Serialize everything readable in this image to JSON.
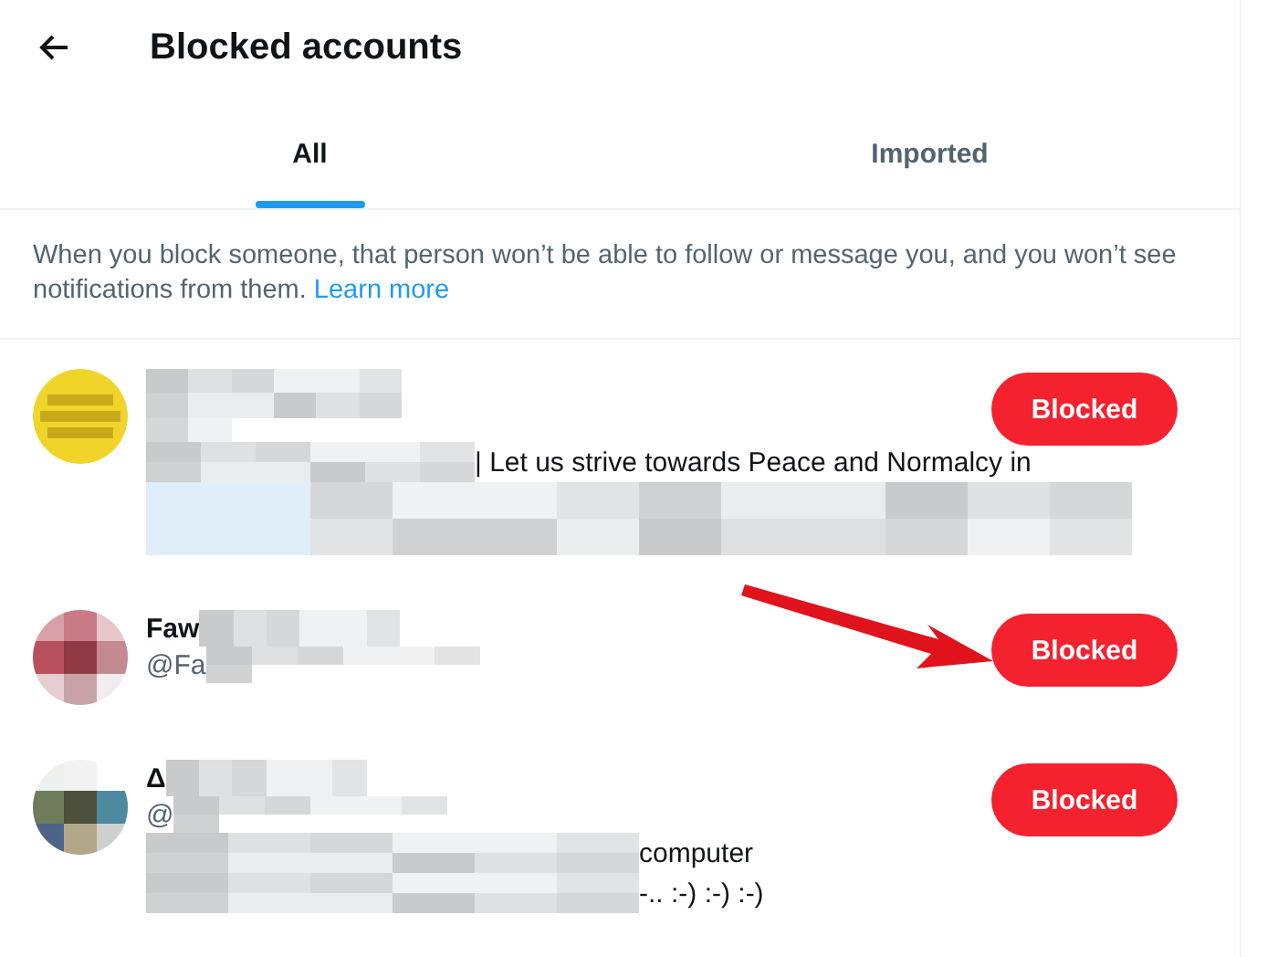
{
  "header": {
    "title": "Blocked accounts"
  },
  "tabs": [
    {
      "label": "All",
      "selected": true
    },
    {
      "label": "Imported",
      "selected": false
    }
  ],
  "notice": {
    "text": "When you block someone, that person won’t be able to follow or message you, and you won’t see notifications from them.",
    "link": "Learn more"
  },
  "accounts": [
    {
      "kind": "picture",
      "bio": [
        "| Let us strive towards Peace and Normalcy in"
      ],
      "button": "Blocked"
    },
    {
      "kind": "pixelated",
      "name": "Faw",
      "handle": "@Fa",
      "button": "Blocked"
    },
    {
      "kind": "pixelated",
      "name": "Δ",
      "handle": "@",
      "bio": [
        "computer",
        "-.. :-) :-) :-)"
      ],
      "button": "Blocked"
    }
  ]
}
